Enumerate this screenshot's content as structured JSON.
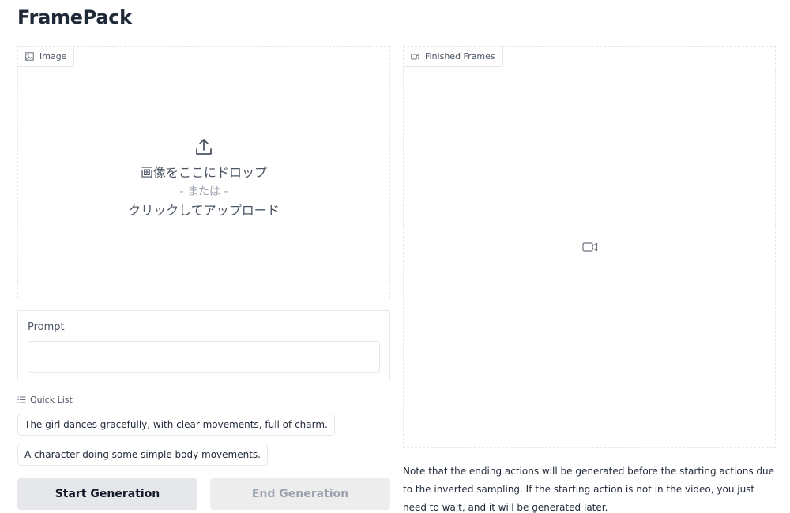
{
  "app": {
    "title": "FramePack"
  },
  "image_panel": {
    "tag_label": "Image",
    "drop_text": "画像をここにドロップ",
    "or_text": "- または -",
    "click_text": "クリックしてアップロード"
  },
  "frames_panel": {
    "tag_label": "Finished Frames"
  },
  "prompt": {
    "label": "Prompt",
    "value": ""
  },
  "quick_list": {
    "label": "Quick List",
    "items": [
      "The girl dances gracefully, with clear movements, full of charm.",
      "A character doing some simple body movements."
    ]
  },
  "buttons": {
    "start": "Start Generation",
    "end": "End Generation"
  },
  "note": "Note that the ending actions will be generated before the starting actions due to the inverted sampling. If the starting action is not in the video, you just need to wait, and it will be generated later.",
  "icons": {
    "image_tag": "image-icon",
    "frames_tag": "video-icon",
    "upload": "upload-icon",
    "placeholder": "video-icon",
    "quick_list": "list-icon"
  },
  "colors": {
    "border": "#e5e7eb",
    "start_button_bg": "#e5e7eb",
    "end_button_bg": "#ededee",
    "muted_text": "#9ca3af"
  }
}
